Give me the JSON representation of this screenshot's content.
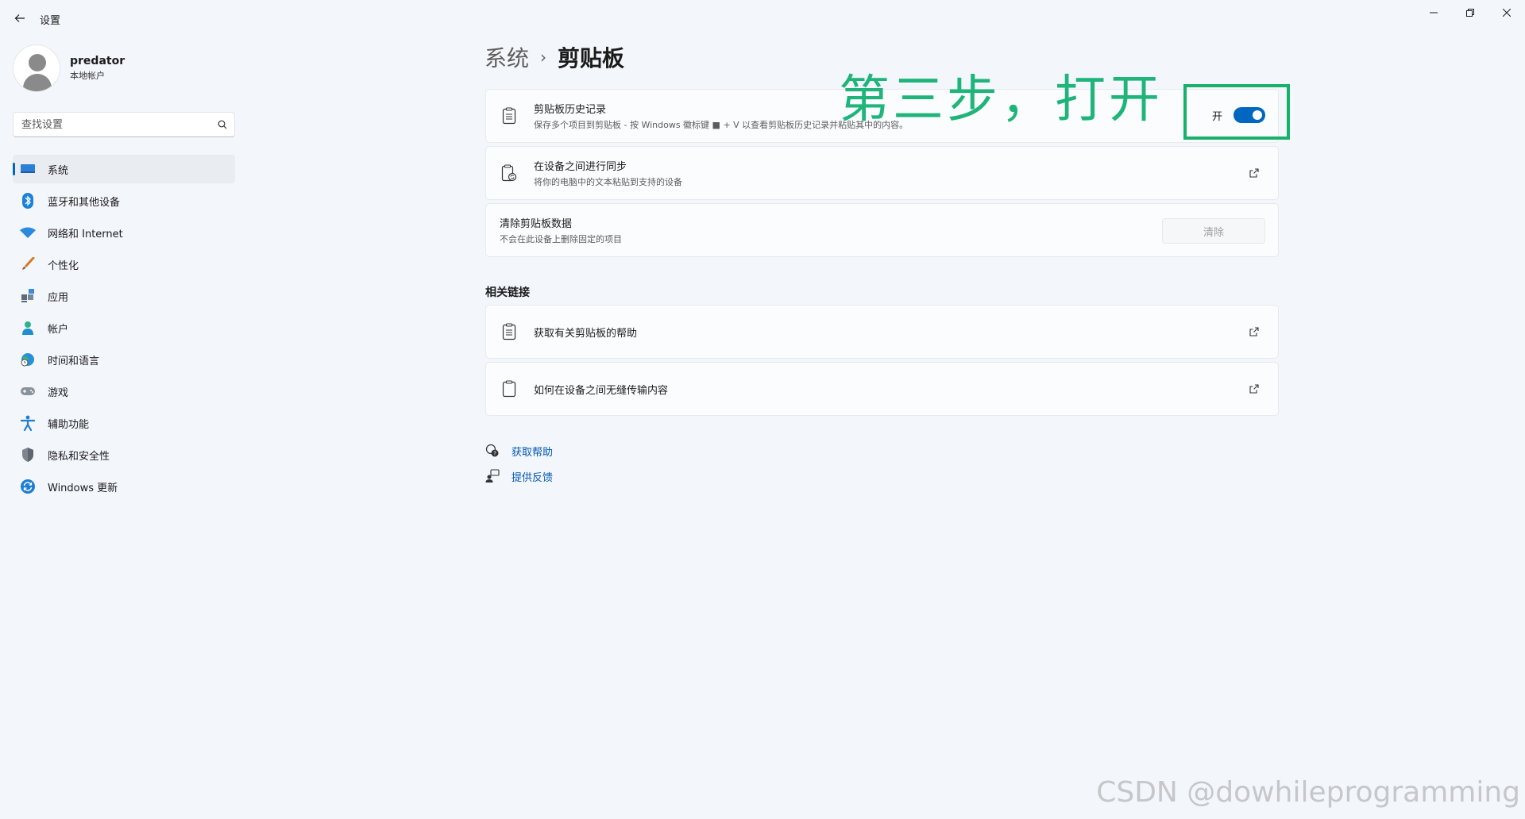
{
  "window": {
    "title": "设置",
    "back_label": "Back",
    "minimize_label": "Minimize",
    "restore_label": "Restore",
    "close_label": "Close"
  },
  "profile": {
    "name": "predator",
    "account_type": "本地帐户"
  },
  "search": {
    "placeholder": "查找设置"
  },
  "sidebar": {
    "items": [
      {
        "label": "系统",
        "icon": "system-monitor-icon",
        "active": true
      },
      {
        "label": "蓝牙和其他设备",
        "icon": "bluetooth-icon"
      },
      {
        "label": "网络和 Internet",
        "icon": "wifi-icon"
      },
      {
        "label": "个性化",
        "icon": "paintbrush-icon"
      },
      {
        "label": "应用",
        "icon": "apps-icon"
      },
      {
        "label": "帐户",
        "icon": "account-icon"
      },
      {
        "label": "时间和语言",
        "icon": "time-language-icon"
      },
      {
        "label": "游戏",
        "icon": "gamepad-icon"
      },
      {
        "label": "辅助功能",
        "icon": "accessibility-icon"
      },
      {
        "label": "隐私和安全性",
        "icon": "shield-icon"
      },
      {
        "label": "Windows 更新",
        "icon": "update-icon"
      }
    ]
  },
  "breadcrumb": {
    "parent": "系统",
    "separator": "›",
    "current": "剪贴板"
  },
  "settings": {
    "history": {
      "title": "剪贴板历史记录",
      "subtitle": "保存多个项目到剪贴板 - 按 Windows 徽标键 ■ + V 以查看剪贴板历史记录并粘贴其中的内容。",
      "toggle_label": "开",
      "toggle_on": true
    },
    "sync": {
      "title": "在设备之间进行同步",
      "subtitle": "将你的电脑中的文本粘贴到支持的设备"
    },
    "clear": {
      "title": "清除剪贴板数据",
      "subtitle": "不会在此设备上删除固定的项目",
      "button_label": "清除"
    }
  },
  "related": {
    "title": "相关链接",
    "links": [
      {
        "label": "获取有关剪贴板的帮助"
      },
      {
        "label": "如何在设备之间无缝传输内容"
      }
    ]
  },
  "footer": {
    "get_help": "获取帮助",
    "feedback": "提供反馈"
  },
  "annotation": {
    "text": "第三步，打开",
    "color": "#1fb57a"
  },
  "watermark": "CSDN @dowhileprogramming",
  "colors": {
    "accent": "#0067c0",
    "link": "#0058b0",
    "background": "#f3f6fb",
    "annotation_box": "#19b16a"
  }
}
